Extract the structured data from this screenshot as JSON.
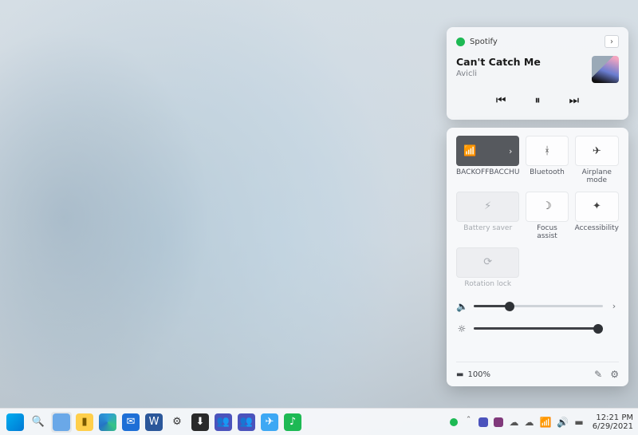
{
  "media": {
    "app_name": "Spotify",
    "title": "Can't Catch Me",
    "artist": "Avicli"
  },
  "quick_settings": {
    "tiles": [
      {
        "label": "BACKOFFBACCHU",
        "icon": "wifi",
        "active": true,
        "disabled": false,
        "has_arrow": true
      },
      {
        "label": "Bluetooth",
        "icon": "bluetooth",
        "active": false,
        "disabled": false,
        "has_arrow": false
      },
      {
        "label": "Airplane mode",
        "icon": "airplane",
        "active": false,
        "disabled": false,
        "has_arrow": false
      },
      {
        "label": "Battery saver",
        "icon": "battery-saver",
        "active": false,
        "disabled": true,
        "has_arrow": false
      },
      {
        "label": "Focus assist",
        "icon": "moon",
        "active": false,
        "disabled": false,
        "has_arrow": false
      },
      {
        "label": "Accessibility",
        "icon": "accessibility",
        "active": false,
        "disabled": false,
        "has_arrow": false
      },
      {
        "label": "Rotation lock",
        "icon": "rotation-lock",
        "active": false,
        "disabled": true,
        "has_arrow": false
      }
    ],
    "volume_percent": 28,
    "brightness_percent": 96,
    "battery_percent_text": "100%"
  },
  "taskbar": {
    "time": "12:21 PM",
    "date": "6/29/2021"
  }
}
